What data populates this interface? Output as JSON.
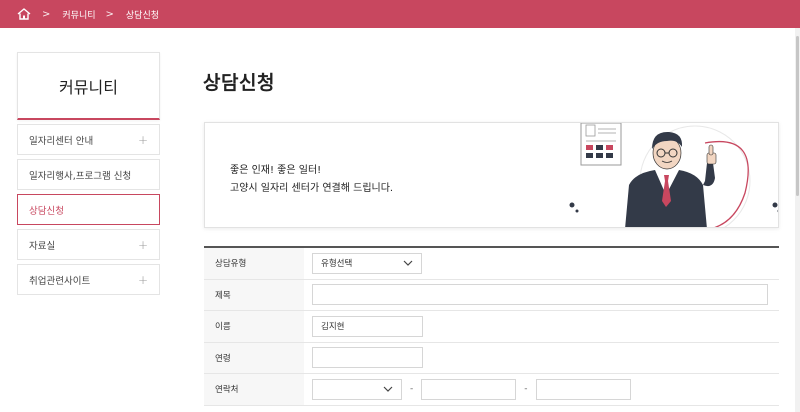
{
  "breadcrumb": {
    "items": [
      "커뮤니티",
      "상담신청"
    ]
  },
  "sidebar": {
    "title": "커뮤니티",
    "items": [
      {
        "label": "일자리센터 안내",
        "expandable": true
      },
      {
        "label": "일자리행사,프로그램 신청",
        "expandable": false
      },
      {
        "label": "상담신청",
        "expandable": false,
        "active": true
      },
      {
        "label": "자료실",
        "expandable": true
      },
      {
        "label": "취업관련사이트",
        "expandable": true
      }
    ],
    "expand_symbol": "+"
  },
  "main": {
    "title": "상담신청",
    "banner": {
      "line1": "좋은 인재! 좋은 일터!",
      "line2": "고양시 일자리 센터가 연결해 드립니다."
    },
    "form": {
      "consult_type": {
        "label": "상담유형",
        "value": "유형선택"
      },
      "subject": {
        "label": "제목",
        "value": ""
      },
      "name": {
        "label": "이름",
        "value": "김지현"
      },
      "age": {
        "label": "연령",
        "value": ""
      },
      "contact": {
        "label": "연락처",
        "prefix_value": "",
        "middle_value": "",
        "last_value": "",
        "separator": "-"
      }
    }
  },
  "colors": {
    "accent": "#c8475f",
    "label_bg": "#f7f7f7",
    "border": "#e4e4e4"
  },
  "icons": {
    "home": "home-icon",
    "breadcrumb_sep": "chevron-right-icon",
    "select": "chevron-down-icon"
  }
}
